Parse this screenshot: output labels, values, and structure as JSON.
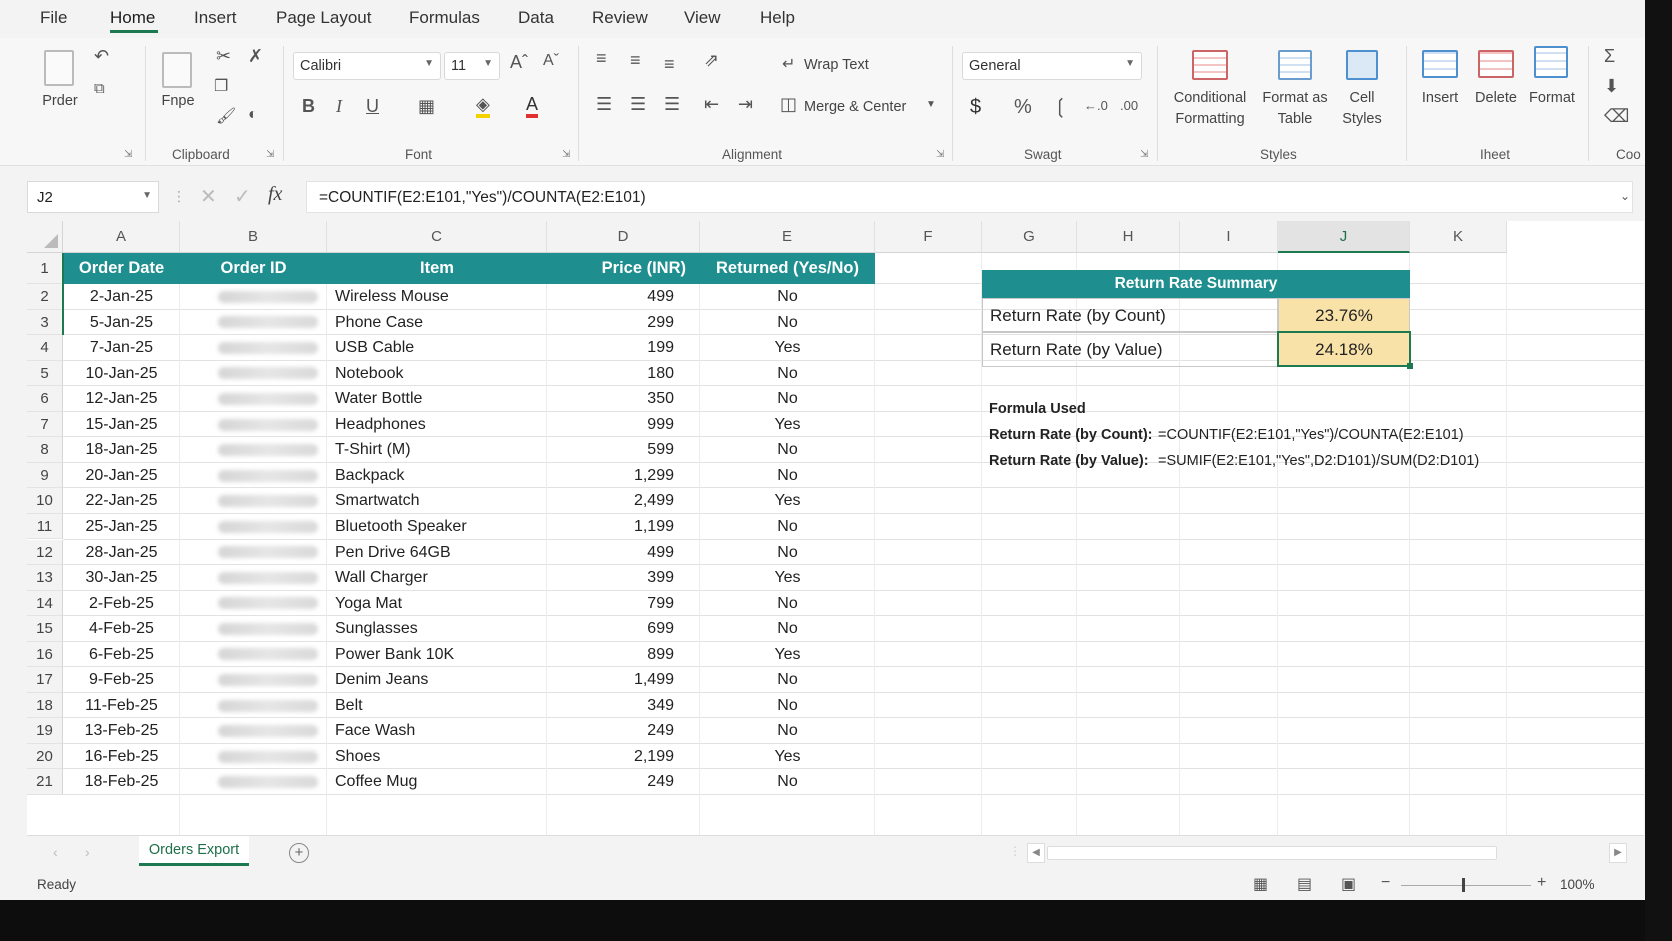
{
  "menu": {
    "tabs": [
      "File",
      "Home",
      "Insert",
      "Page Layout",
      "Formulas",
      "Data",
      "Review",
      "View",
      "Help"
    ],
    "active": "Home"
  },
  "ribbon": {
    "paste_label": "Prder",
    "clipboard_paste_label": "Fnpe",
    "clipboard_label": "Clipboard",
    "font_name": "Calibri",
    "font_size": "11",
    "font_label": "Font",
    "wrap_text": "Wrap Text",
    "merge_center": "Merge & Center",
    "alignment_label": "Alignment",
    "number_format": "General",
    "number_label": "Swagt",
    "conditional_formatting_1": "Conditional",
    "conditional_formatting_2": "Formatting",
    "format_as_table_1": "Format as",
    "format_as_table_2": "Table",
    "cell_styles_1": "Cell",
    "cell_styles_2": "Styles",
    "styles_label": "Styles",
    "insert": "Insert",
    "delete": "Delete",
    "format": "Format",
    "cells_label": "Iheet",
    "editing_label": "Coo"
  },
  "formula_bar": {
    "name_box": "J2",
    "fx": "fx",
    "formula": "=COUNTIF(E2:E101,\"Yes\")/COUNTA(E2:E101)"
  },
  "columns": [
    "A",
    "B",
    "C",
    "D",
    "E",
    "F",
    "G",
    "H",
    "I",
    "J",
    "K"
  ],
  "table": {
    "headers": [
      "Order Date",
      "Order ID",
      "Item",
      "Price (INR)",
      "Returned (Yes/No)"
    ],
    "rows": [
      [
        "2-Jan-25",
        "Wireless Mouse",
        "499",
        "No"
      ],
      [
        "5-Jan-25",
        "Phone Case",
        "299",
        "No"
      ],
      [
        "7-Jan-25",
        "USB Cable",
        "199",
        "Yes"
      ],
      [
        "10-Jan-25",
        "Notebook",
        "180",
        "No"
      ],
      [
        "12-Jan-25",
        "Water Bottle",
        "350",
        "No"
      ],
      [
        "15-Jan-25",
        "Headphones",
        "999",
        "Yes"
      ],
      [
        "18-Jan-25",
        "T-Shirt (M)",
        "599",
        "No"
      ],
      [
        "20-Jan-25",
        "Backpack",
        "1,299",
        "No"
      ],
      [
        "22-Jan-25",
        "Smartwatch",
        "2,499",
        "Yes"
      ],
      [
        "25-Jan-25",
        "Bluetooth Speaker",
        "1,199",
        "No"
      ],
      [
        "28-Jan-25",
        "Pen Drive 64GB",
        "499",
        "No"
      ],
      [
        "30-Jan-25",
        "Wall Charger",
        "399",
        "Yes"
      ],
      [
        "2-Feb-25",
        "Yoga Mat",
        "799",
        "No"
      ],
      [
        "4-Feb-25",
        "Sunglasses",
        "699",
        "No"
      ],
      [
        "6-Feb-25",
        "Power Bank 10K",
        "899",
        "Yes"
      ],
      [
        "9-Feb-25",
        "Denim Jeans",
        "1,499",
        "No"
      ],
      [
        "11-Feb-25",
        "Belt",
        "349",
        "No"
      ],
      [
        "13-Feb-25",
        "Face Wash",
        "249",
        "No"
      ],
      [
        "16-Feb-25",
        "Shoes",
        "2,199",
        "Yes"
      ],
      [
        "18-Feb-25",
        "Coffee Mug",
        "249",
        "No"
      ]
    ]
  },
  "summary": {
    "title": "Return Rate Summary",
    "by_count_label": "Return Rate (by Count)",
    "by_count_value": "23.76%",
    "by_value_label": "Return Rate (by Value)",
    "by_value_value": "24.18%",
    "formula_used": "Formula Used",
    "count_formula_label": "Return Rate (by Count):",
    "count_formula": "=COUNTIF(E2:E101,\"Yes\")/COUNTA(E2:E101)",
    "value_formula_label": "Return Rate (by Value):",
    "value_formula": "=SUMIF(E2:E101,\"Yes\",D2:D101)/SUM(D2:D101)"
  },
  "sheet_tab": "Orders Export",
  "status": {
    "ready": "Ready",
    "zoom": "100%"
  },
  "colors": {
    "header_teal": "#1e8e8e",
    "highlight": "#f8e2a8",
    "accent_green": "#1d7a50"
  }
}
